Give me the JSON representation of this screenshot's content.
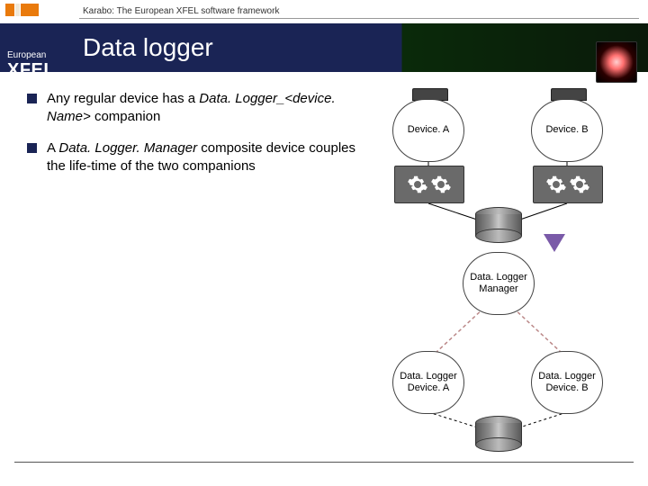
{
  "header": {
    "kicker": "Karabo: The European XFEL software framework",
    "logo_top": "European",
    "logo_main": "XFEL",
    "title": "Data logger"
  },
  "bullets": [
    {
      "pre": "Any regular device has a ",
      "em": "Data. Logger_<device. Name>",
      "post": " companion"
    },
    {
      "pre": "A ",
      "em": "Data. Logger. Manager",
      "post": " composite device couples the life-time of the two companions"
    }
  ],
  "diagram": {
    "deviceA": "Device. A",
    "deviceB": "Device. B",
    "managerL1": "Data. Logger",
    "managerL2": "Manager",
    "loggerA_L1": "Data. Logger",
    "loggerA_L2": "Device. A",
    "loggerB_L1": "Data. Logger",
    "loggerB_L2": "Device. B"
  }
}
